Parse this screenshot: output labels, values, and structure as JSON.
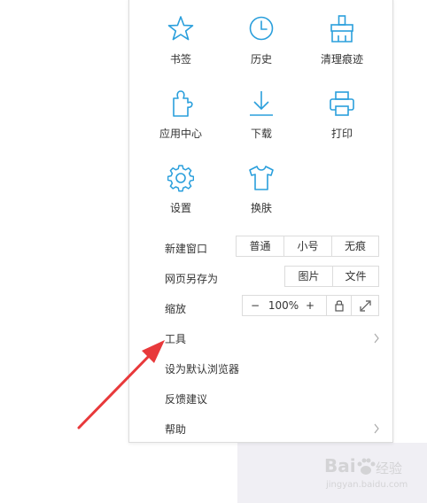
{
  "grid": [
    {
      "label": "书签",
      "icon": "star-icon"
    },
    {
      "label": "历史",
      "icon": "clock-icon"
    },
    {
      "label": "清理痕迹",
      "icon": "broom-icon"
    },
    {
      "label": "应用中心",
      "icon": "puzzle-icon"
    },
    {
      "label": "下载",
      "icon": "download-icon"
    },
    {
      "label": "打印",
      "icon": "printer-icon"
    },
    {
      "label": "设置",
      "icon": "gear-icon"
    },
    {
      "label": "换肤",
      "icon": "tshirt-icon"
    }
  ],
  "new_window": {
    "label": "新建窗口",
    "options": [
      "普通",
      "小号",
      "无痕"
    ]
  },
  "save_as": {
    "label": "网页另存为",
    "options": [
      "图片",
      "文件"
    ]
  },
  "zoom": {
    "label": "缩放",
    "minus": "−",
    "value": "100%",
    "plus": "+"
  },
  "menu_items": [
    {
      "label": "工具",
      "has_submenu": true
    },
    {
      "label": "设为默认浏览器",
      "has_submenu": false
    },
    {
      "label": "反馈建议",
      "has_submenu": false
    },
    {
      "label": "帮助",
      "has_submenu": true
    }
  ],
  "watermark": {
    "brand": "Bai",
    "brand_sub": "经验",
    "url": "jingyan.baidu.com"
  },
  "colors": {
    "icon": "#2a9fdc",
    "arrow": "#e8393b",
    "border": "#dcdcdc"
  }
}
